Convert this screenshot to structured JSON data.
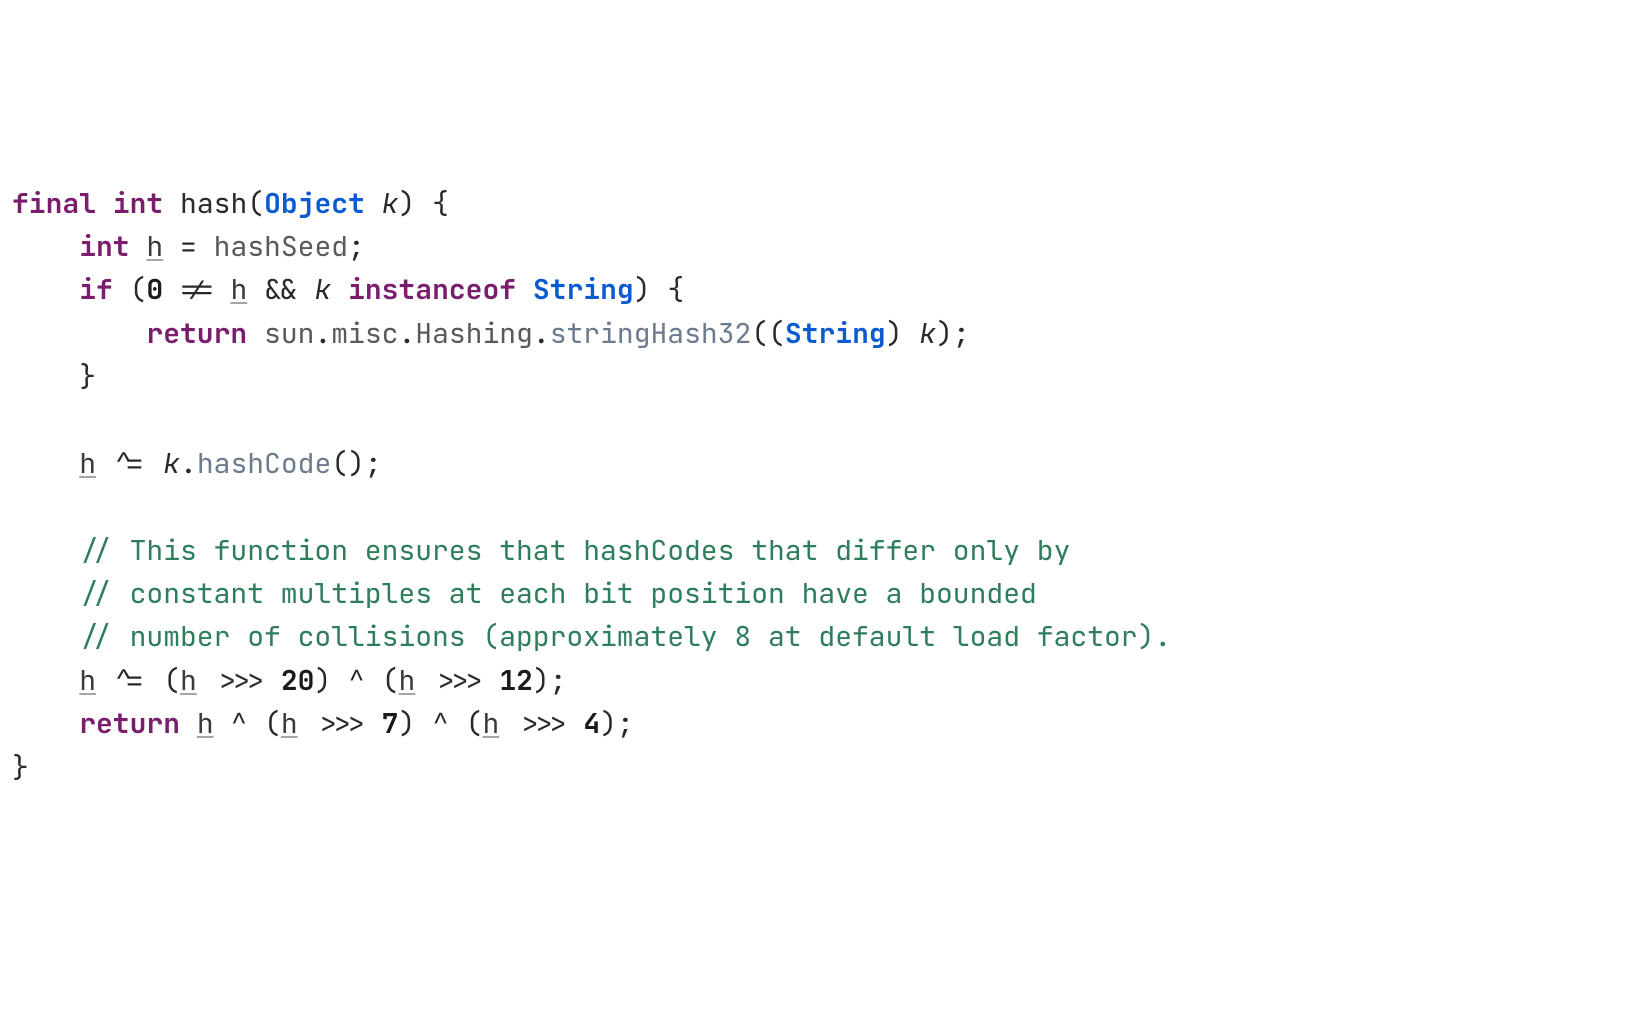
{
  "code": {
    "line1": {
      "kw_final": "final",
      "kw_int": "int",
      "fn_name": "hash",
      "lparen": "(",
      "type_object": "Object",
      "param_k": "k",
      "rparen_brace": ") {"
    },
    "line2": {
      "indent": "    ",
      "kw_int": "int",
      "var_h": "h",
      "eq": " = ",
      "hashSeed": "hashSeed",
      "semi": ";"
    },
    "line3": {
      "indent": "    ",
      "kw_if": "if",
      "lparen": " (",
      "zero": "0",
      "neq": " != ",
      "var_h": "h",
      "and": " && ",
      "param_k": "k",
      "sp": " ",
      "kw_instanceof": "instanceof",
      "sp2": " ",
      "type_string": "String",
      "rparen_brace": ") {"
    },
    "line4": {
      "indent": "        ",
      "kw_return": "return",
      "sp": " ",
      "pkg_sun": "sun",
      "dot1": ".",
      "pkg_misc": "misc",
      "dot2": ".",
      "cls_hashing": "Hashing",
      "dot3": ".",
      "m_stringHash32": "stringHash32",
      "lparen": "((",
      "type_string": "String",
      "rparen_sp": ") ",
      "param_k": "k",
      "rparen_semi": ");"
    },
    "line5": {
      "indent": "    ",
      "rbrace": "}"
    },
    "line6_blank": "",
    "line7": {
      "indent": "    ",
      "var_h": "h",
      "xor_eq": " ^= ",
      "param_k": "k",
      "dot": ".",
      "m_hashCode": "hashCode",
      "parens_semi": "();"
    },
    "line8_blank": "",
    "line9": {
      "indent": "    ",
      "cmt": "// This function ensures that hashCodes that differ only by"
    },
    "line10": {
      "indent": "    ",
      "cmt": "// constant multiples at each bit position have a bounded"
    },
    "line11": {
      "indent": "    ",
      "cmt": "// number of collisions (approximately 8 at default load factor)."
    },
    "line12": {
      "indent": "    ",
      "var_h1": "h",
      "xor_eq": " ^= (",
      "var_h2": "h",
      "shift1": " >>> ",
      "n20": "20",
      "mid": ") ^ (",
      "var_h3": "h",
      "shift2": " >>> ",
      "n12": "12",
      "end": ");"
    },
    "line13": {
      "indent": "    ",
      "kw_return": "return",
      "sp": " ",
      "var_h1": "h",
      "mid1": " ^ (",
      "var_h2": "h",
      "shift1": " >>> ",
      "n7": "7",
      "mid2": ") ^ (",
      "var_h3": "h",
      "shift2": " >>> ",
      "n4": "4",
      "end": ");"
    },
    "line14": {
      "rbrace": "}"
    }
  }
}
